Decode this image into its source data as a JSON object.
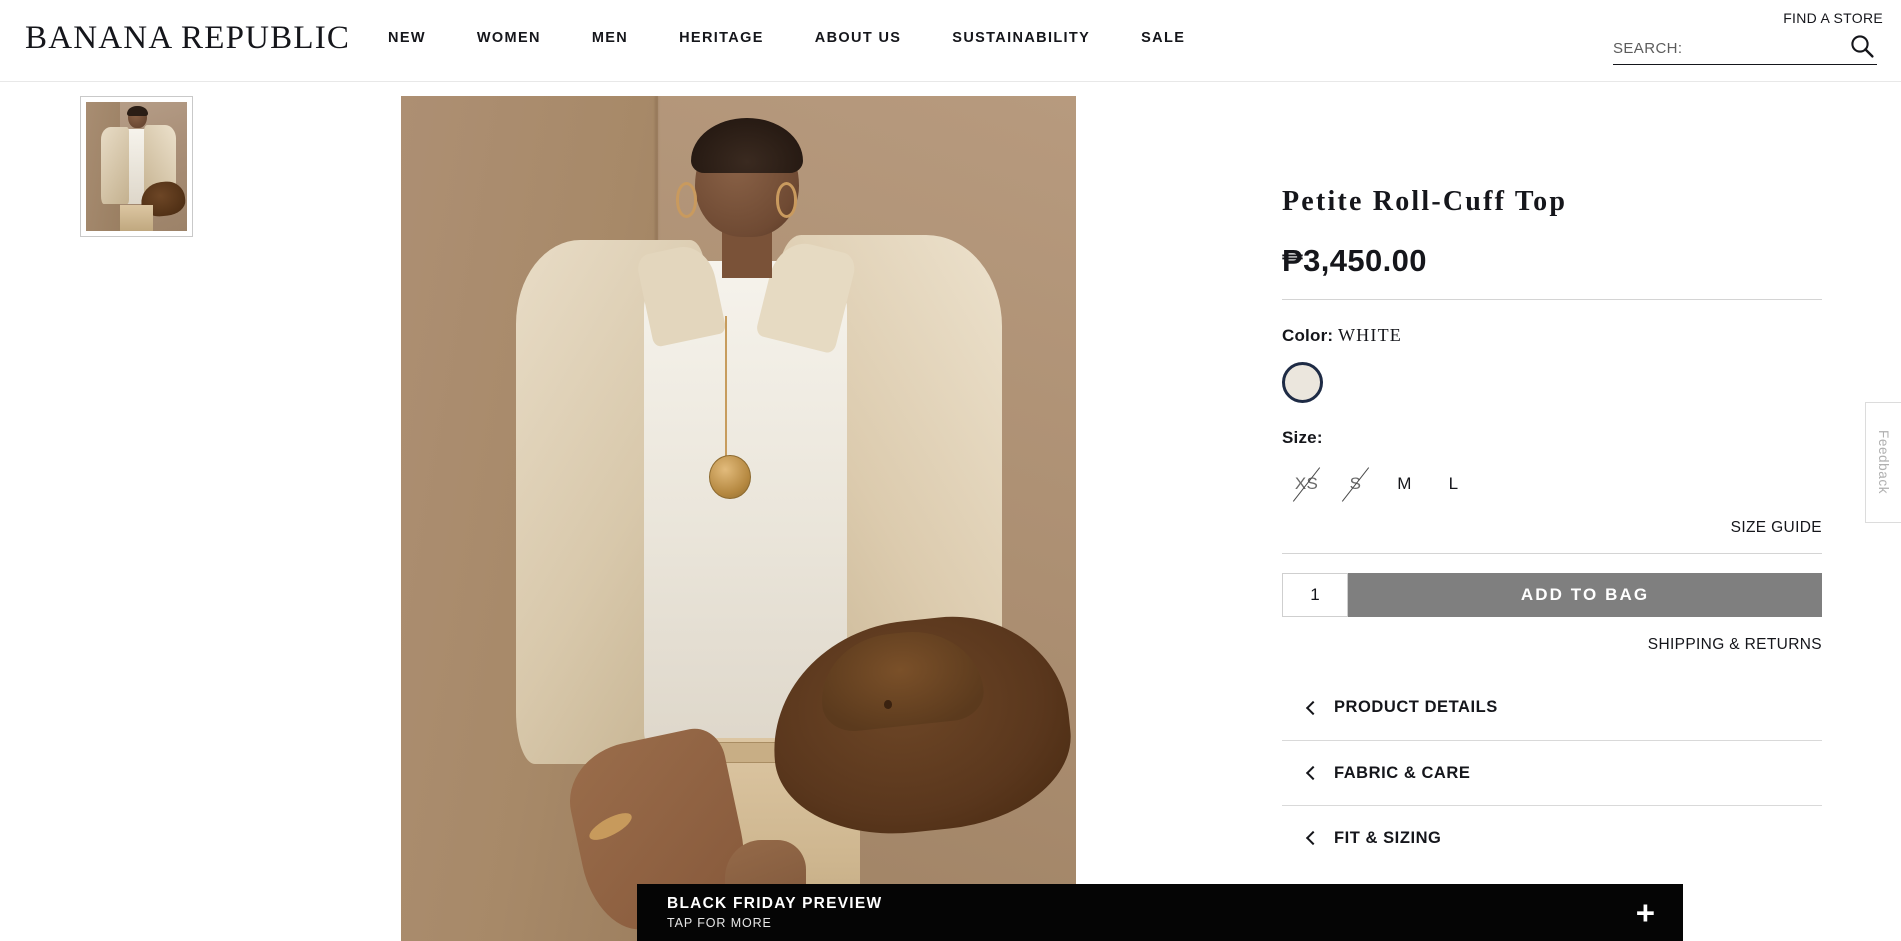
{
  "header": {
    "logo": "BANANA REPUBLIC",
    "nav": [
      {
        "label": "NEW"
      },
      {
        "label": "WOMEN"
      },
      {
        "label": "MEN"
      },
      {
        "label": "HERITAGE"
      },
      {
        "label": "ABOUT US"
      },
      {
        "label": "SUSTAINABILITY"
      },
      {
        "label": "SALE"
      }
    ],
    "find_store": "FIND A STORE",
    "search_placeholder": "SEARCH:",
    "search_value": "",
    "search_icon": "search-icon"
  },
  "gallery": {
    "thumbnails": [
      {
        "alt": "Model wearing Petite Roll-Cuff Top with jacket and hat",
        "selected": true
      }
    ],
    "main_image_alt": "Model in white roll-cuff top and beige jacket holding brown hat"
  },
  "promo": {
    "title": "BLACK FRIDAY PREVIEW",
    "subtitle": "TAP FOR MORE",
    "expand_icon": "plus-icon"
  },
  "product": {
    "title": "Petite Roll-Cuff Top",
    "price": "₱3,450.00",
    "color_label": "Color:",
    "color_value": "WHITE",
    "swatches": [
      {
        "name": "WHITE",
        "hex": "#ebe6dd",
        "selected": true
      }
    ],
    "size_label": "Size:",
    "sizes": [
      {
        "label": "XS",
        "available": false
      },
      {
        "label": "S",
        "available": false
      },
      {
        "label": "M",
        "available": true
      },
      {
        "label": "L",
        "available": true
      }
    ],
    "size_guide": "SIZE GUIDE",
    "quantity": "1",
    "add_to_bag": "ADD TO BAG",
    "shipping_returns": "SHIPPING & RETURNS",
    "accordions": [
      {
        "label": "PRODUCT DETAILS",
        "icon": "chevron-left-icon",
        "expanded": false
      },
      {
        "label": "FABRIC & CARE",
        "icon": "chevron-left-icon",
        "expanded": false
      },
      {
        "label": "FIT & SIZING",
        "icon": "chevron-left-icon",
        "expanded": false
      }
    ]
  },
  "feedback": {
    "label": "Feedback"
  },
  "colors": {
    "accent_swatch_ring": "#1e2b45",
    "add_to_bag_bg": "#7f7f7f",
    "promo_bg": "#050505",
    "text": "#15161b"
  }
}
